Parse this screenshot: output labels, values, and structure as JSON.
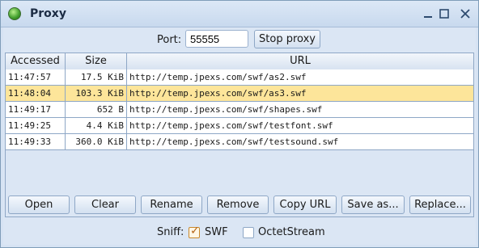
{
  "window": {
    "title": "Proxy",
    "icon": "proxy-globe-icon",
    "controls": [
      "minimize-icon",
      "maximize-icon",
      "close-icon"
    ]
  },
  "port": {
    "label": "Port:",
    "value": "55555",
    "stop_button": "Stop proxy"
  },
  "table": {
    "columns": [
      "Accessed",
      "Size",
      "URL"
    ],
    "rows": [
      {
        "accessed": "11:47:57",
        "size": "17.5 KiB",
        "url": "http://temp.jpexs.com/swf/as2.swf",
        "selected": false
      },
      {
        "accessed": "11:48:04",
        "size": "103.3 KiB",
        "url": "http://temp.jpexs.com/swf/as3.swf",
        "selected": true
      },
      {
        "accessed": "11:49:17",
        "size": "652 B",
        "url": "http://temp.jpexs.com/swf/shapes.swf",
        "selected": false
      },
      {
        "accessed": "11:49:25",
        "size": "4.4 KiB",
        "url": "http://temp.jpexs.com/swf/testfont.swf",
        "selected": false
      },
      {
        "accessed": "11:49:33",
        "size": "360.0 KiB",
        "url": "http://temp.jpexs.com/swf/testsound.swf",
        "selected": false
      }
    ]
  },
  "actions": {
    "open": "Open",
    "clear": "Clear",
    "rename": "Rename",
    "remove": "Remove",
    "copy_url": "Copy URL",
    "save_as": "Save as...",
    "replace": "Replace..."
  },
  "sniff": {
    "label": "Sniff:",
    "swf": {
      "label": "SWF",
      "checked": true
    },
    "octet": {
      "label": "OctetStream",
      "checked": false
    }
  },
  "colors": {
    "selected_row": "#fde59a",
    "window_bg": "#dbe6f4",
    "border": "#8ea7c6"
  }
}
